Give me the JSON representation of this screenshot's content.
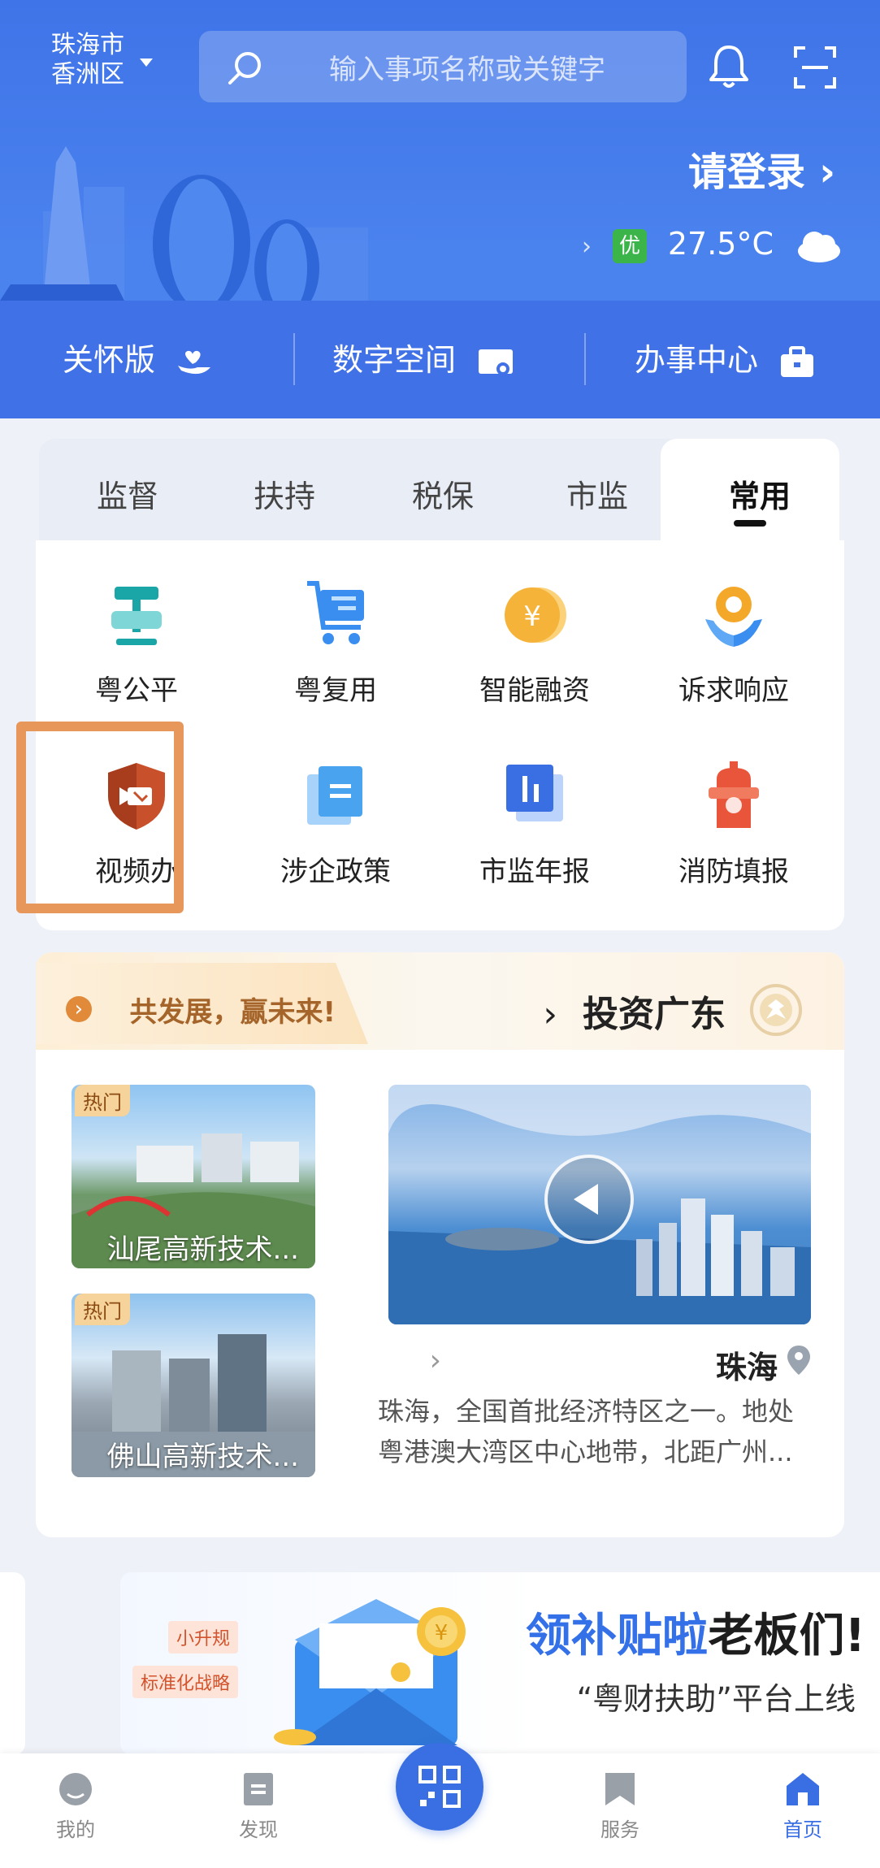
{
  "header": {
    "city_line1": "珠海市",
    "city_line2": "香洲区",
    "search_placeholder": "输入事项名称或关键字",
    "login_label": "请登录",
    "temperature": "27.5°C",
    "air_quality": "优"
  },
  "quick_bar": [
    {
      "label": "办事中心",
      "icon": "briefcase-icon"
    },
    {
      "label": "数字空间",
      "icon": "monitor-icon"
    },
    {
      "label": "关怀版",
      "icon": "care-hand-icon"
    }
  ],
  "tabs": [
    "常用",
    "市监",
    "税保",
    "扶持",
    "监督"
  ],
  "active_tab": "常用",
  "services": [
    {
      "label": "诉求响应",
      "icon": "gear-hands-icon",
      "color": "#f0a020"
    },
    {
      "label": "智能融资",
      "icon": "yuan-coin-icon",
      "color": "#f5b33a"
    },
    {
      "label": "粤复用",
      "icon": "cart-icon",
      "color": "#3a8ef0"
    },
    {
      "label": "粤公平",
      "icon": "scales-icon",
      "color": "#1aa6a6"
    },
    {
      "label": "消防填报",
      "icon": "hydrant-icon",
      "color": "#e8553a"
    },
    {
      "label": "市监年报",
      "icon": "bar-chart-icon",
      "color": "#3a6fe4"
    },
    {
      "label": "涉企政策",
      "icon": "document-icon",
      "color": "#4aa3ef"
    },
    {
      "label": "视频办",
      "icon": "video-shield-icon",
      "color": "#c8502a"
    }
  ],
  "invest": {
    "title": "投资广东",
    "slogan": "共发展，赢未来!",
    "video_city": "珠海",
    "video_description": "珠海，全国首批经济特区之一。地处粤港澳大湾区中心地带，北距广州...",
    "thumbs": [
      {
        "badge": "热门",
        "label": "汕尾高新技术..."
      },
      {
        "badge": "热门",
        "label": "佛山高新技术..."
      }
    ]
  },
  "banner": {
    "title_part1": "老板们!",
    "title_part2": "领补贴啦",
    "subtitle": "“粤财扶助”平台上线",
    "tag1": "小升规",
    "tag2": "标准化战略"
  },
  "bottom_nav": [
    {
      "label": "首页",
      "active": true
    },
    {
      "label": "服务",
      "active": false
    },
    {
      "label": "发现",
      "active": false
    },
    {
      "label": "我的",
      "active": false
    }
  ]
}
